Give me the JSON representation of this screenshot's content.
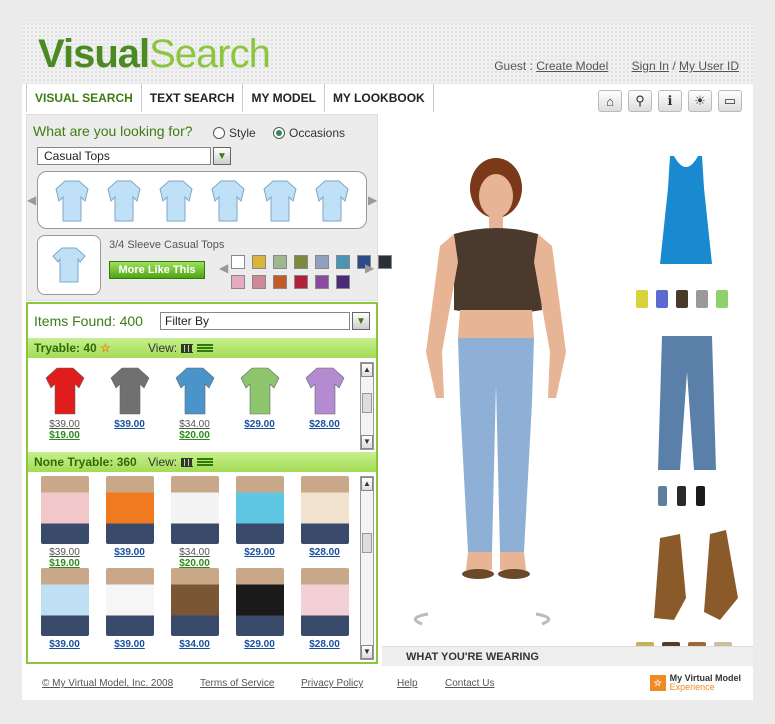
{
  "logo": {
    "part1": "Visual",
    "part2": "Search"
  },
  "account": {
    "guest": "Guest :",
    "create_model": "Create Model",
    "sign_in": "Sign In",
    "sep": "/",
    "user_id": "My User ID"
  },
  "tabs": [
    "VISUAL SEARCH",
    "TEXT SEARCH",
    "MY MODEL",
    "MY LOOKBOOK"
  ],
  "toolbar": {
    "icons": [
      "home-icon",
      "zoom-icon",
      "info-icon",
      "vacation-icon",
      "print-icon"
    ]
  },
  "search": {
    "question": "What are you looking for?",
    "option_style": "Style",
    "option_occasions": "Occasions",
    "selected": "Occasions",
    "category": "Casual Tops",
    "selected_item": "3/4 Sleeve Casual Tops",
    "more_like_this": "More Like This"
  },
  "strip_colors": [
    "#bfe0f7",
    "#bfe0f7",
    "#bfe0f7",
    "#bfe0f7",
    "#bfe0f7",
    "#bfe0f7"
  ],
  "swatches": [
    "#ffffff",
    "#d9b53a",
    "#9db88d",
    "#7c8a3b",
    "#8fa0c0",
    "#4a95b5",
    "#2a4a8a",
    "#2a2f3a",
    "#e6aac0",
    "#cc8a96",
    "#c25a2a",
    "#b0223a",
    "#8a4aa0",
    "#4a2a7a"
  ],
  "results": {
    "found_label": "Items Found:",
    "found_count": "400",
    "filter": "Filter By"
  },
  "tryable": {
    "label": "Tryable: 40",
    "view": "View:",
    "items": [
      {
        "color": "#e01c1c",
        "p1": "$39.00",
        "p2": "$19.00"
      },
      {
        "color": "#707070",
        "p1": "$39.00",
        "p2": ""
      },
      {
        "color": "#4a94cc",
        "p1": "$34.00",
        "p2": "$20.00"
      },
      {
        "color": "#8cc56c",
        "p1": "$29.00",
        "p2": ""
      },
      {
        "color": "#b48ad0",
        "p1": "$28.00",
        "p2": ""
      }
    ]
  },
  "nontryable": {
    "label": "None Tryable: 360",
    "view": "View:",
    "items": [
      {
        "color": "#f2c7c9",
        "p1": "$39.00",
        "p2": "$19.00"
      },
      {
        "color": "#f07a20",
        "p1": "$39.00",
        "p2": ""
      },
      {
        "color": "#f4f4f4",
        "p1": "$34.00",
        "p2": "$20.00"
      },
      {
        "color": "#5ec7e3",
        "p1": "$29.00",
        "p2": ""
      },
      {
        "color": "#f1e1cf",
        "p1": "$28.00",
        "p2": ""
      },
      {
        "color": "#bfe0f2",
        "p1": "$39.00",
        "p2": ""
      },
      {
        "color": "#f6f6f6",
        "p1": "$39.00",
        "p2": ""
      },
      {
        "color": "#7a5634",
        "p1": "$34.00",
        "p2": ""
      },
      {
        "color": "#1a1a1a",
        "p1": "$29.00",
        "p2": ""
      },
      {
        "color": "#f2d0d6",
        "p1": "$28.00",
        "p2": ""
      }
    ]
  },
  "wardrobe": {
    "top_colors": [
      "#d9d23a",
      "#5a6ad0",
      "#4a3a2a",
      "#9a9a9a",
      "#8cd16c"
    ],
    "bottom_colors": [
      "#5f7fa0",
      "#2a2a2a",
      "#1a1a1a"
    ],
    "shoe_colors": [
      "#c8b05a",
      "#5a3a2a",
      "#9a6a3a",
      "#c8c0a0"
    ]
  },
  "wearing": "WHAT YOU'RE WEARING",
  "footer": {
    "copyright": "© My Virtual Model, Inc. 2008",
    "terms": "Terms of Service",
    "privacy": "Privacy Policy",
    "help": "Help",
    "contact": "Contact Us",
    "brand": "My Virtual Model",
    "brand2": "Experience"
  }
}
